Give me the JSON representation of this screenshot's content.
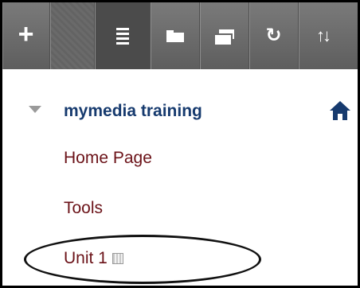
{
  "toolbar": {
    "buttons": [
      {
        "icon": "plus-icon",
        "active": false
      },
      {
        "icon": "drag-grip-icon",
        "active": false
      },
      {
        "icon": "list-icon",
        "active": true
      },
      {
        "icon": "folder-icon",
        "active": false
      },
      {
        "icon": "window-icon",
        "active": false
      },
      {
        "icon": "refresh-icon",
        "active": false
      },
      {
        "icon": "sort-icon",
        "active": false
      }
    ],
    "colors": {
      "background": "#666666",
      "active": "#4b4b4b",
      "icon": "#ffffff"
    }
  },
  "course": {
    "title": "mymedia training",
    "title_color": "#163a6e",
    "expanded": true
  },
  "menu": {
    "items": [
      {
        "label": "Home Page"
      },
      {
        "label": "Tools"
      },
      {
        "label": "Unit 1",
        "badge_icon": "hidden-from-students-icon"
      }
    ],
    "text_color": "#6b1218"
  },
  "annotation": {
    "shape": "ellipse",
    "highlighted_item": "Unit 1"
  }
}
